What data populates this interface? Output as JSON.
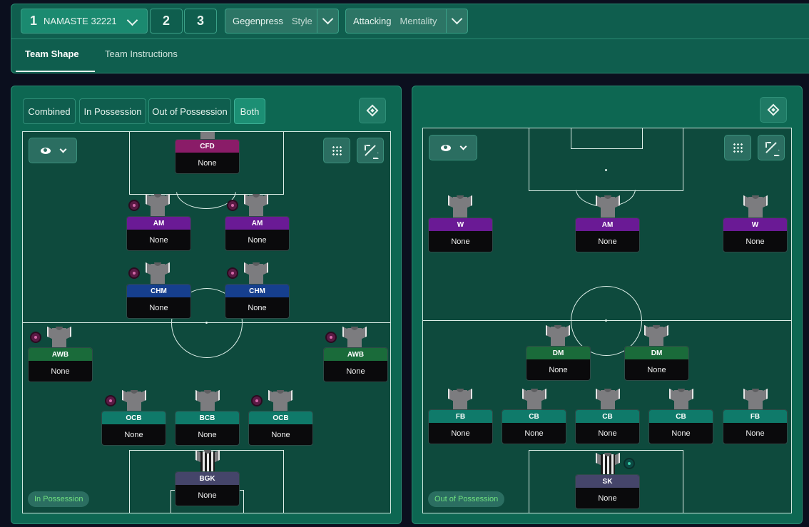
{
  "topbar": {
    "tactic_number": "1",
    "tactic_name": "NAMASTE 32221",
    "slot2": "2",
    "slot3": "3",
    "style_value": "Gegenpress",
    "style_label": "Style",
    "mentality_value": "Attacking",
    "mentality_label": "Mentality"
  },
  "tabs": {
    "team_shape": "Team Shape",
    "team_instructions": "Team Instructions"
  },
  "mode_buttons": {
    "combined": "Combined",
    "in_possession": "In Possession",
    "out_of_possession": "Out of Possession",
    "both": "Both"
  },
  "colors": {
    "gk": "#45456a",
    "cfd": "#8a1c68",
    "am": "#6a1a95",
    "chm": "#163f8e",
    "wb": "#1a6b3a",
    "def": "#0f7a6a",
    "dm": "#1a6b3a"
  },
  "left": {
    "phase_label": "In Possession",
    "players": [
      {
        "role": "CFD",
        "name": "None"
      },
      {
        "role": "AM",
        "name": "None"
      },
      {
        "role": "AM",
        "name": "None"
      },
      {
        "role": "CHM",
        "name": "None"
      },
      {
        "role": "CHM",
        "name": "None"
      },
      {
        "role": "AWB",
        "name": "None"
      },
      {
        "role": "AWB",
        "name": "None"
      },
      {
        "role": "OCB",
        "name": "None"
      },
      {
        "role": "BCB",
        "name": "None"
      },
      {
        "role": "OCB",
        "name": "None"
      },
      {
        "role": "BGK",
        "name": "None"
      }
    ]
  },
  "right": {
    "phase_label": "Out of Possession",
    "players": [
      {
        "role": "W",
        "name": "None"
      },
      {
        "role": "AM",
        "name": "None"
      },
      {
        "role": "W",
        "name": "None"
      },
      {
        "role": "DM",
        "name": "None"
      },
      {
        "role": "DM",
        "name": "None"
      },
      {
        "role": "FB",
        "name": "None"
      },
      {
        "role": "CB",
        "name": "None"
      },
      {
        "role": "CB",
        "name": "None"
      },
      {
        "role": "CB",
        "name": "None"
      },
      {
        "role": "FB",
        "name": "None"
      },
      {
        "role": "SK",
        "name": "None"
      }
    ]
  }
}
